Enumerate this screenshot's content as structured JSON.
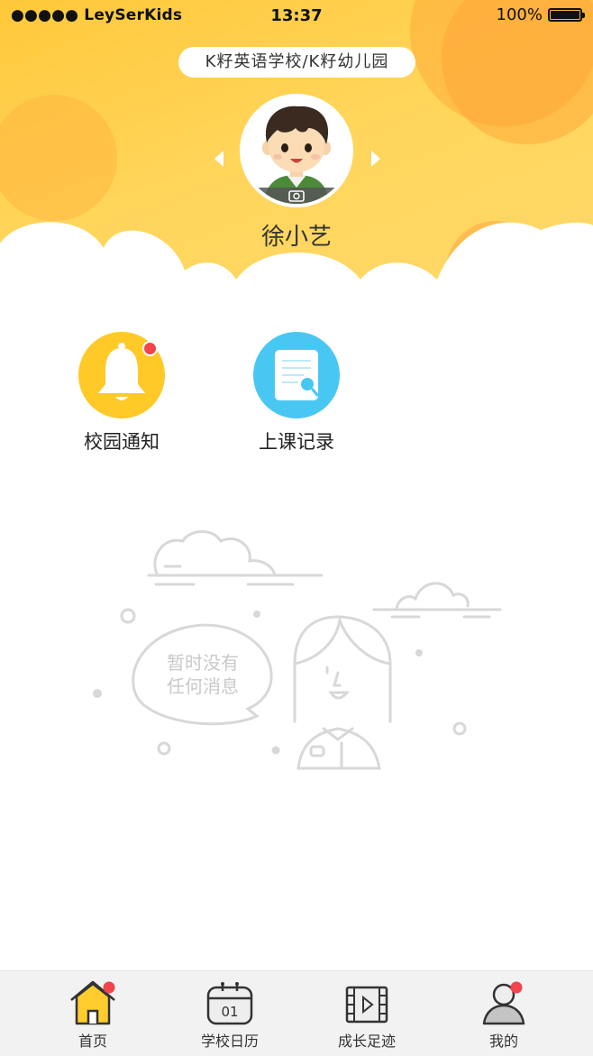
{
  "status_bar": {
    "carrier": "●●●●● LeySerKids",
    "time": "13:37",
    "battery": "100%"
  },
  "header": {
    "school": "K籽英语学校/K籽幼儿园",
    "student_name": "徐小艺"
  },
  "features": [
    {
      "label": "校园通知",
      "icon": "bell-icon",
      "color": "#ffc928",
      "has_badge": true
    },
    {
      "label": "上课记录",
      "icon": "document-search-icon",
      "color": "#49c7f3",
      "has_badge": false
    }
  ],
  "empty_state": {
    "line1": "暂时没有",
    "line2": "任何消息"
  },
  "tabbar": {
    "items": [
      {
        "label": "首页",
        "icon": "home-icon",
        "active": true,
        "badge": true
      },
      {
        "label": "学校日历",
        "icon": "calendar-icon",
        "calendar_day": "01"
      },
      {
        "label": "成长足迹",
        "icon": "video-film-icon"
      },
      {
        "label": "我的",
        "icon": "person-icon",
        "badge": true
      }
    ]
  },
  "colors": {
    "header_yellow": "#ffcc40",
    "accent_red": "#f0454c",
    "bell_yellow": "#ffc928",
    "record_blue": "#49c7f3"
  }
}
